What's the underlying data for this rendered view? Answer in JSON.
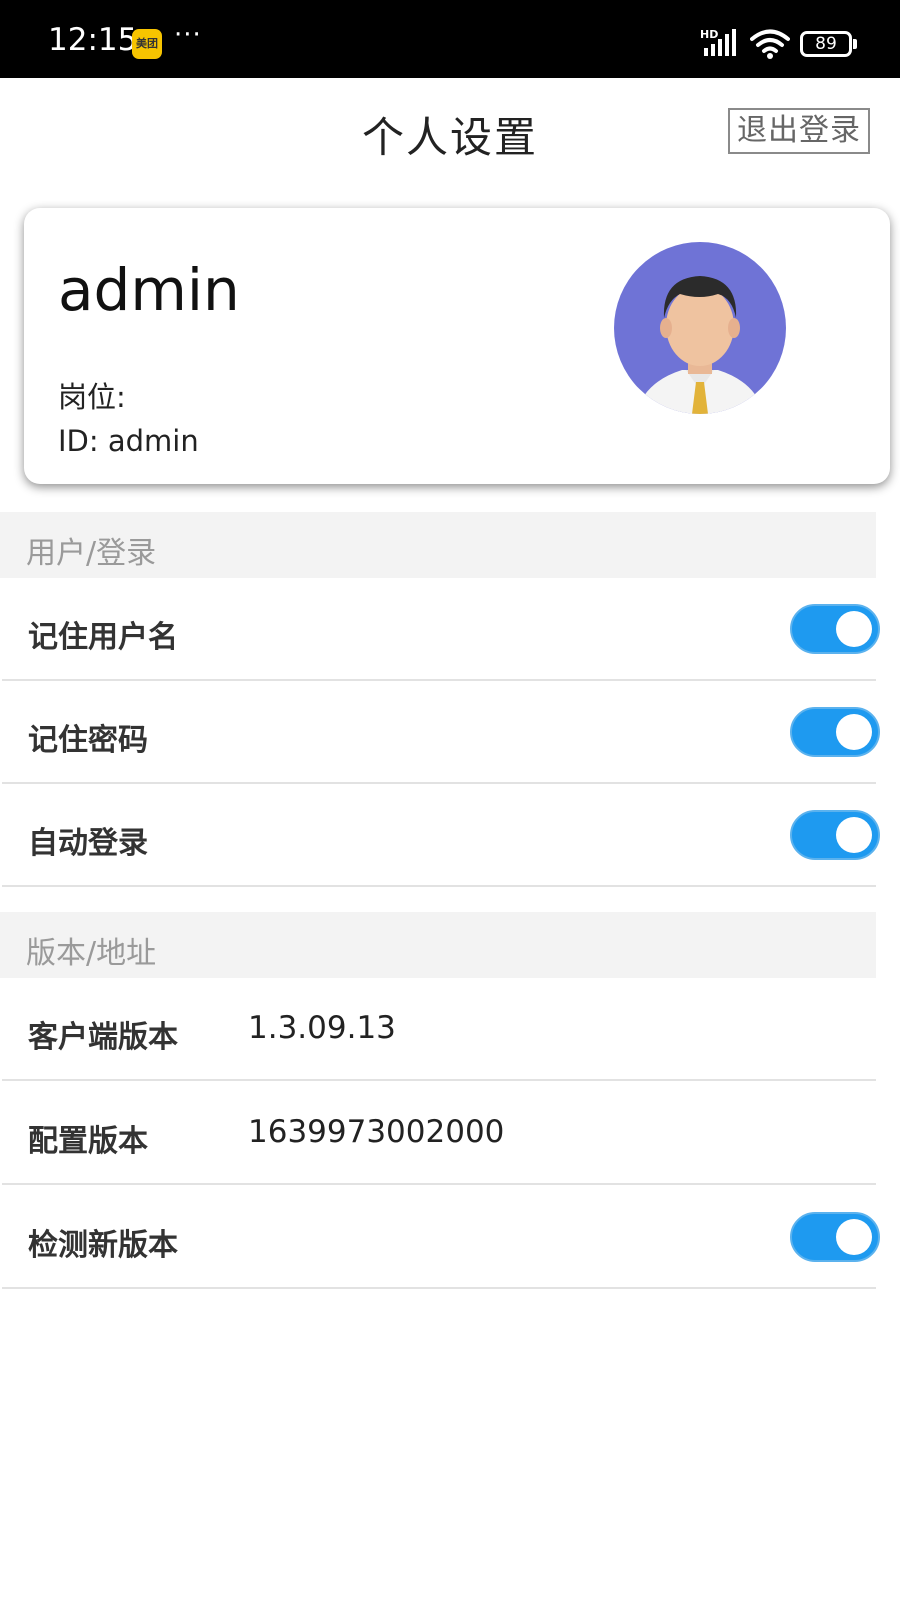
{
  "status_bar": {
    "time": "12:15",
    "app_badge": "美团",
    "more": "···",
    "network": "HD",
    "battery": "89"
  },
  "header": {
    "title": "个人设置",
    "logout_label": "退出登录"
  },
  "profile": {
    "username": "admin",
    "position_label": "岗位:",
    "id_label": "ID: admin"
  },
  "sections": {
    "user_login": {
      "title": "用户/登录",
      "rows": [
        {
          "label": "记住用户名",
          "toggle_on": true
        },
        {
          "label": "记住密码",
          "toggle_on": true
        },
        {
          "label": "自动登录",
          "toggle_on": true
        }
      ]
    },
    "version": {
      "title": "版本/地址",
      "rows": [
        {
          "label": "客户端版本",
          "value": "1.3.09.13"
        },
        {
          "label": "配置版本",
          "value": "1639973002000"
        },
        {
          "label": "检测新版本",
          "toggle_on": true
        }
      ]
    }
  },
  "colors": {
    "toggle_on": "#1e9af0",
    "avatar_bg": "#6f73d6",
    "section_bg": "#f3f3f3"
  }
}
